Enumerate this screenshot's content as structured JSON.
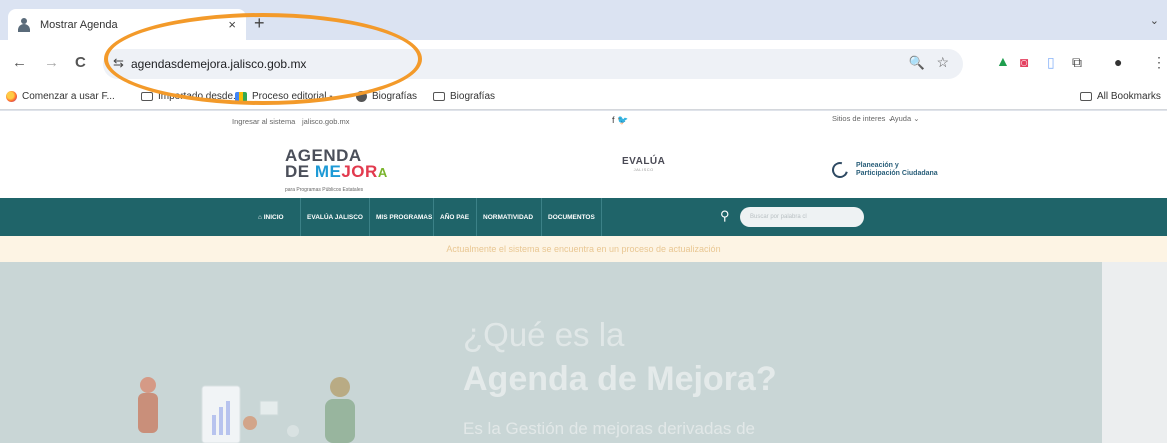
{
  "browser": {
    "tab": {
      "title": "Mostrar Agenda",
      "close": "×"
    },
    "new_tab": "+",
    "tab_search": "⌄",
    "toolbar": {
      "back": "←",
      "forward": "→",
      "reload": "C",
      "site_info": "⇆",
      "url": "agendasdemejora.jalisco.gob.mx",
      "zoom": "🔍",
      "star": "☆",
      "menu": "⋮"
    },
    "bookmarks": [
      {
        "label": "Comenzar a usar F..."
      },
      {
        "label": "Importado desde..."
      },
      {
        "label": "Proceso editorial -..."
      },
      {
        "label": "Biografías"
      },
      {
        "label": "Biografías"
      }
    ],
    "all_bookmarks": "All Bookmarks"
  },
  "site": {
    "top_links": {
      "login": "Ingresar al sistema",
      "portal": "jalisco.gob.mx",
      "social": "f  🐦",
      "interest": "Sitios de interes ⌄",
      "help": "Ayuda ⌄"
    },
    "logo_agenda": {
      "line1": "AGENDA",
      "line2_a": "DE ",
      "line2_b": "ME",
      "line2_c": "JOR",
      "line2_d": "A",
      "tagline": "para Programas Públicos Estatales"
    },
    "logo_evalua": {
      "name": "EVALÚA",
      "sub": "JALISCO"
    },
    "logo_plan": {
      "line1": "Planeación y",
      "line2": "Participación Ciudadana"
    },
    "nav": [
      "INICIO",
      "EVALÚA JALISCO",
      "MIS PROGRAMAS",
      "AÑO PAE",
      "NORMATIVIDAD",
      "DOCUMENTOS"
    ],
    "search_placeholder": "Buscar por palabra cl",
    "notice": "Actualmente el sistema se encuentra en un proceso de actualización",
    "hero": {
      "title1": "¿Qué es la",
      "title2": "Agenda de Mejora?",
      "subtitle": "Es la Gestión de mejoras derivadas de"
    }
  },
  "colors": {
    "nav_bg": "#1f6469",
    "annotation": "#f39a2a",
    "hero_bg": "#c9d6d6"
  }
}
